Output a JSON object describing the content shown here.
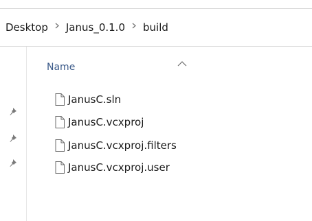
{
  "breadcrumb": {
    "items": [
      "Desktop",
      "Janus_0.1.0",
      "build"
    ],
    "separator_icon": "chevron-right-icon"
  },
  "columns": {
    "name_header": "Name",
    "sort_icon": "sort-ascending-icon"
  },
  "quick_access": {
    "pin_icon": "pin-icon",
    "pin_count": 3
  },
  "files": [
    {
      "name": "JanusC.sln",
      "icon": "file-icon"
    },
    {
      "name": "JanusC.vcxproj",
      "icon": "file-icon"
    },
    {
      "name": "JanusC.vcxproj.filters",
      "icon": "file-icon"
    },
    {
      "name": "JanusC.vcxproj.user",
      "icon": "file-icon"
    }
  ],
  "colors": {
    "header_text": "#3b5a89",
    "divider": "#d9d9d9",
    "pin": "#7a7a7a"
  }
}
